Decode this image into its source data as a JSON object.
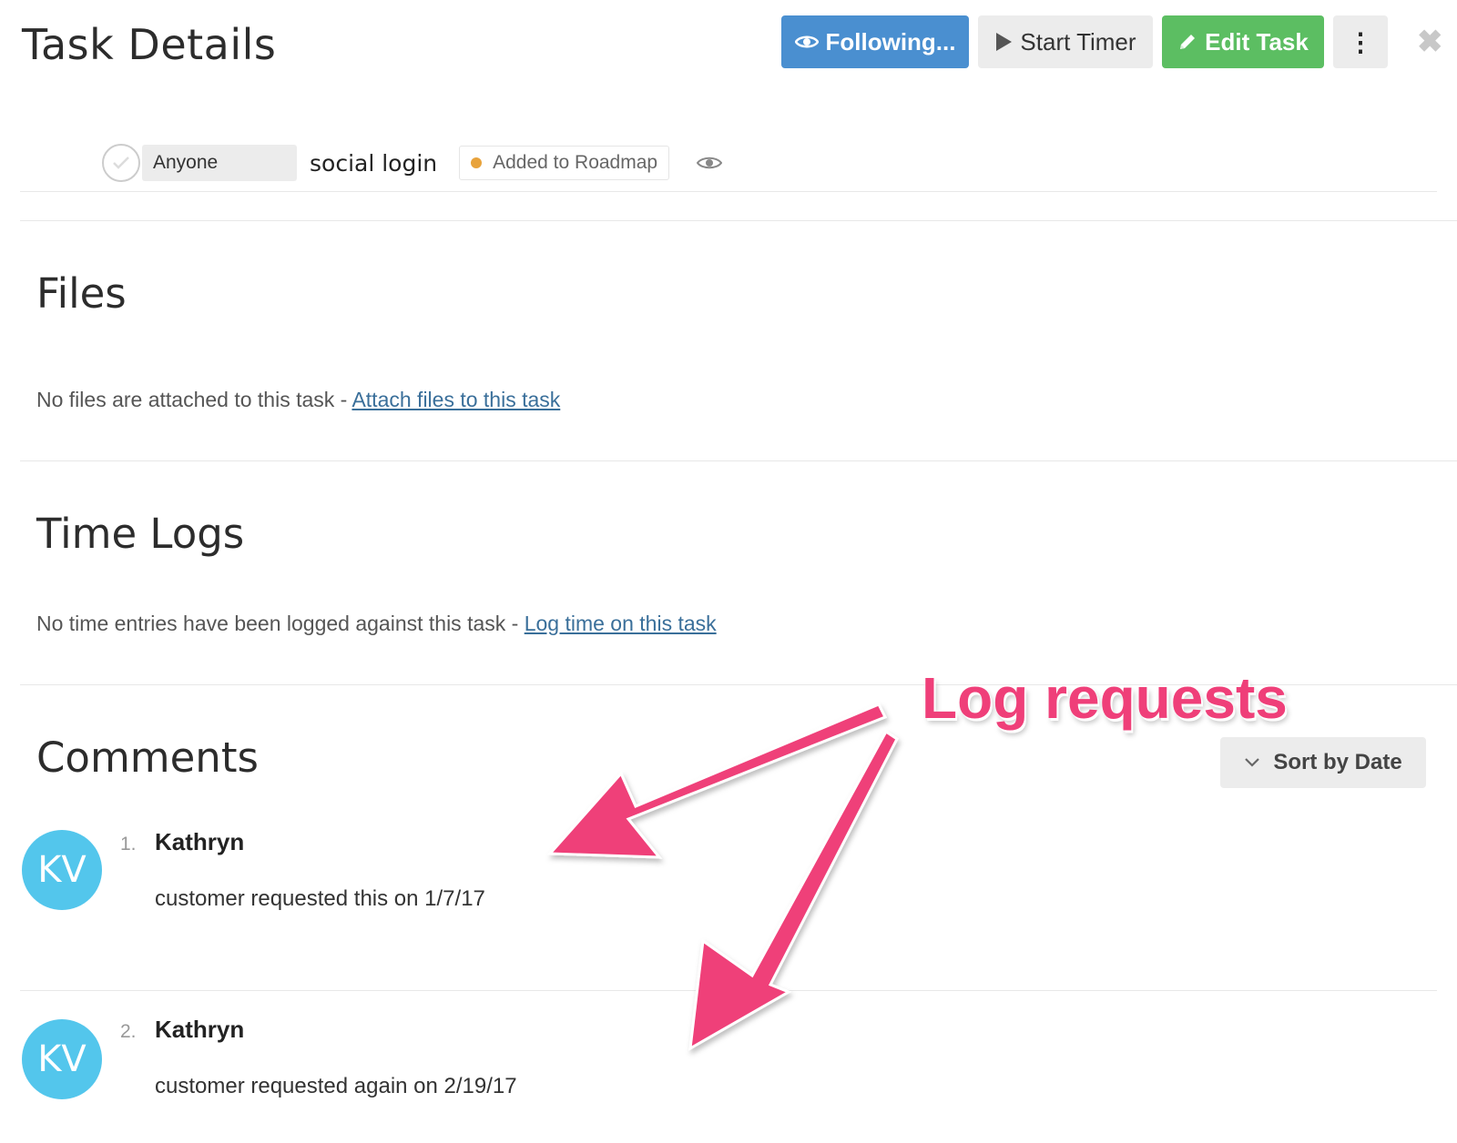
{
  "header": {
    "title": "Task Details",
    "following_label": "Following...",
    "start_timer_label": "Start Timer",
    "edit_task_label": "Edit Task",
    "more_label": "⋮",
    "close_label": "✖"
  },
  "task": {
    "assignee": "Anyone",
    "name": "social login",
    "status": "Added to Roadmap"
  },
  "files": {
    "title": "Files",
    "empty_text": "No files are attached to this task - ",
    "link_text": "Attach files to this task"
  },
  "time_logs": {
    "title": "Time Logs",
    "empty_text": "No time entries have been logged against this task - ",
    "link_text": "Log time on this task"
  },
  "comments": {
    "title": "Comments",
    "sort_label": "Sort by Date",
    "items": [
      {
        "number": "1.",
        "initials": "KV",
        "author": "Kathryn",
        "body": "customer requested this on 1/7/17"
      },
      {
        "number": "2.",
        "initials": "KV",
        "author": "Kathryn",
        "body": "customer requested again on 2/19/17"
      }
    ]
  },
  "annotation": {
    "label": "Log requests"
  },
  "colors": {
    "following": "#4a8fd0",
    "edit": "#5cbe62",
    "status_dot": "#e8a33c",
    "avatar": "#53c6ec",
    "annotation": "#ef3f79",
    "link": "#3a6f9a"
  },
  "icons": {
    "following": "eye-icon",
    "timer": "play-icon",
    "edit": "pencil-icon",
    "sort": "chevron-down-icon",
    "close": "close-icon",
    "complete": "check-icon",
    "watch": "eye-icon"
  }
}
